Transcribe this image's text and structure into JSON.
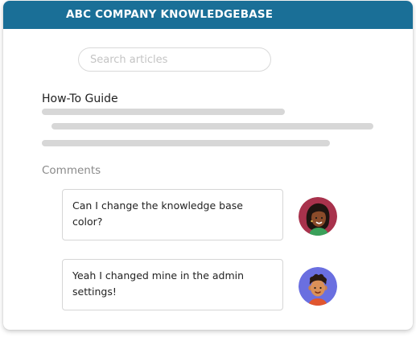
{
  "header": {
    "title": "ABC COMPANY KNOWLEDGEBASE",
    "bg_color": "#1a6f97"
  },
  "search": {
    "placeholder": "Search articles",
    "value": ""
  },
  "article": {
    "title": "How-To Guide"
  },
  "comments": {
    "label": "Comments",
    "items": [
      {
        "text": "Can I change the knowledge base color?",
        "avatar_icon": "avatar-woman-icon",
        "avatar_bg": "#a8324c"
      },
      {
        "text": "Yeah I changed mine in the admin settings!",
        "avatar_icon": "avatar-man-icon",
        "avatar_bg": "#6a6fe0"
      }
    ]
  }
}
